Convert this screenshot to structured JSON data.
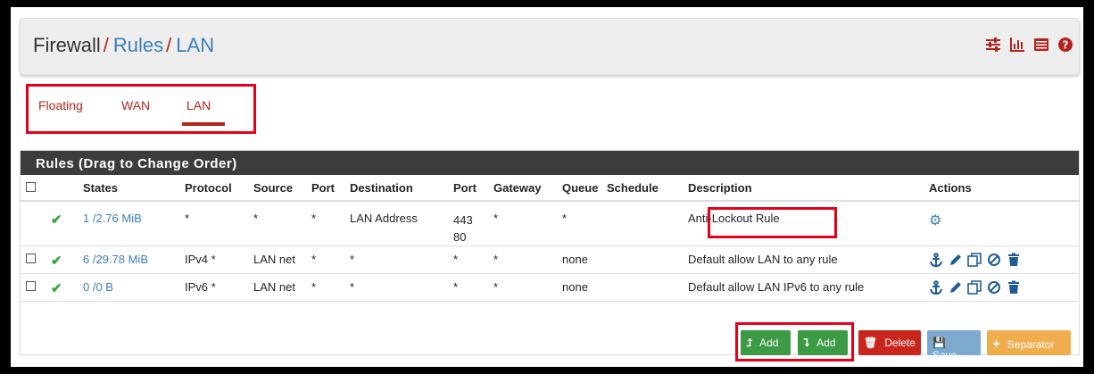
{
  "breadcrumb": {
    "part1": "Firewall",
    "sep": "/",
    "part2": "Rules",
    "part3": "LAN"
  },
  "header_icons": [
    "sliders-icon",
    "bar-chart-icon",
    "list-icon",
    "help-icon"
  ],
  "tabs": [
    "Floating",
    "WAN",
    "LAN"
  ],
  "active_tab": "LAN",
  "panel_title": "Rules (Drag to Change Order)",
  "columns": [
    "States",
    "Protocol",
    "Source",
    "Port",
    "Destination",
    "Port",
    "Gateway",
    "Queue",
    "Schedule",
    "Description",
    "Actions"
  ],
  "rows": [
    {
      "states": "1 /2.76 MiB",
      "protocol": "*",
      "source": "*",
      "port": "*",
      "destination": "LAN Address",
      "dport": "443\n80",
      "gateway": "*",
      "queue": "*",
      "schedule": "",
      "description": "Anti-Lockout Rule"
    },
    {
      "states": "6 /29.78 MiB",
      "protocol": "IPv4 *",
      "source": "LAN net",
      "port": "*",
      "destination": "*",
      "dport": "*",
      "gateway": "*",
      "queue": "none",
      "schedule": "",
      "description": "Default allow LAN to any rule"
    },
    {
      "states": "0 /0 B",
      "protocol": "IPv6 *",
      "source": "LAN net",
      "port": "*",
      "destination": "*",
      "dport": "*",
      "gateway": "*",
      "queue": "none",
      "schedule": "",
      "description": "Default allow LAN IPv6 to any rule"
    }
  ],
  "buttons": {
    "add_top": "Add",
    "add_bottom": "Add",
    "delete": "Delete",
    "save": "Save",
    "separator": "Separator"
  },
  "colors": {
    "accent_red": "#b5241c",
    "link_blue": "#3c7eb8",
    "add_green": "#3c9a45",
    "delete_red": "#c8261c",
    "save_blue": "#7da9cf",
    "separator_orange": "#f0ad4e",
    "highlight_red": "#e6001c"
  }
}
